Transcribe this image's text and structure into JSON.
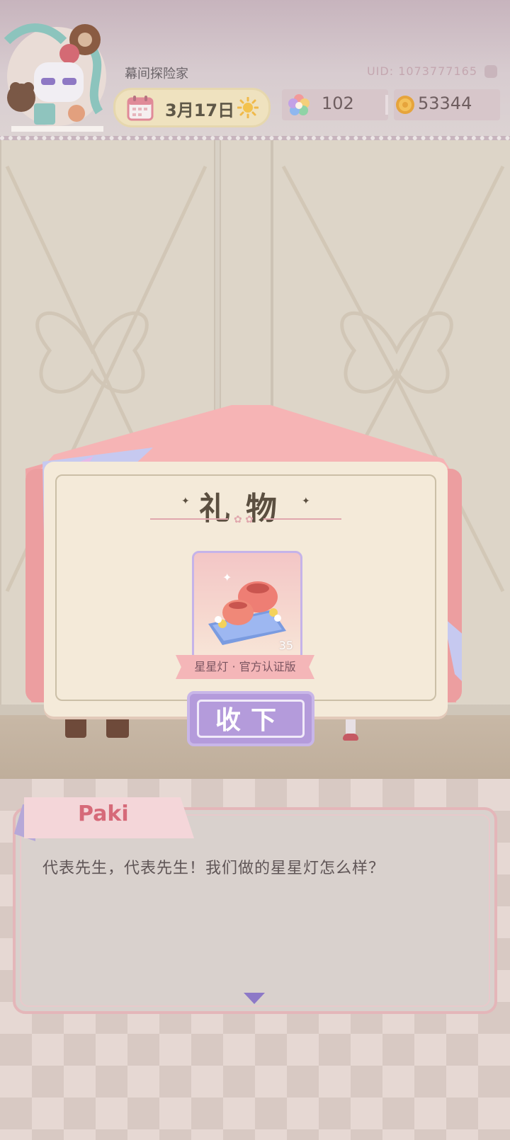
{
  "hud": {
    "player_name": "幕间探险家",
    "uid": "UID: 1073777165",
    "date": "3月17日",
    "weather_icon": "sun-icon",
    "resources": [
      {
        "icon": "rainbow-gem-icon",
        "value": "102"
      },
      {
        "icon": "coin-icon",
        "value": "53344"
      }
    ]
  },
  "gift": {
    "title": "礼物",
    "item_name": "星星灯 · 官方认证版",
    "item_count": "35",
    "accept_label": "收下"
  },
  "dialog": {
    "speaker": "Paki",
    "text": "代表先生，代表先生！我们做的星星灯怎么样？",
    "next_icon": "triangle-down-icon"
  },
  "colors": {
    "accent_pink": "#f4b6b8",
    "button_purple": "#b49bdb",
    "speaker_pink": "#d66a79"
  }
}
